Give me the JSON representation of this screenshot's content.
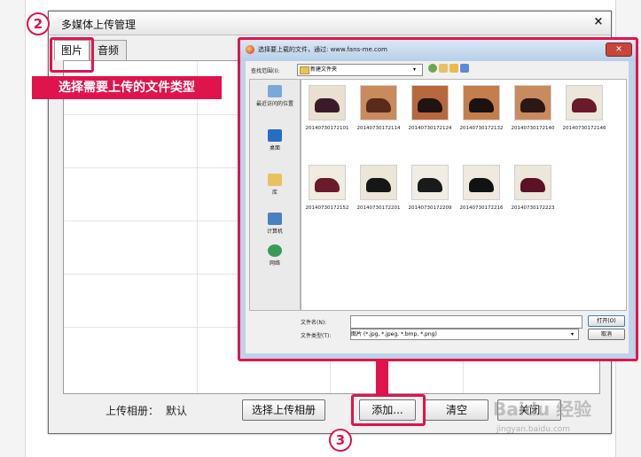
{
  "main_dialog": {
    "title": "多媒体上传管理",
    "close_glyph": "×",
    "tabs": [
      "图片",
      "音频"
    ],
    "album_label": "上传相册：",
    "album_value": "默认",
    "buttons": {
      "choose_album": "选择上传相册",
      "add": "添加...",
      "clear": "清空",
      "close": "关闭"
    }
  },
  "annotations": {
    "step2": "2",
    "step3": "3",
    "callout": "选择需要上传的文件类型",
    "accent_color": "#e0144c"
  },
  "file_dialog": {
    "title": "选择要上载的文件，通过: www.fans-me.com",
    "look_in_label": "查找范围(I):",
    "look_in_value": "新建文件夹",
    "places": [
      {
        "label": "最近访问的位置",
        "icon": "recent-places-icon"
      },
      {
        "label": "桌面",
        "icon": "desktop-icon"
      },
      {
        "label": "库",
        "icon": "library-icon"
      },
      {
        "label": "计算机",
        "icon": "computer-icon"
      },
      {
        "label": "网络",
        "icon": "network-icon"
      }
    ],
    "files": [
      "20140730172101",
      "20140730172114",
      "20140730172124",
      "20140730172132",
      "20140730172140",
      "20140730172146",
      "20140730172152",
      "20140730172201",
      "20140730172209",
      "20140730172216",
      "20140730172223"
    ],
    "filename_label": "文件名(N):",
    "filename_value": "",
    "filetype_label": "文件类型(T):",
    "filetype_value": "图片 (*.jpg, *.jpeg, *.bmp, *.png)",
    "open_button": "打开(O)",
    "cancel_button": "取消"
  },
  "watermark": {
    "text": "Baidu 经验",
    "url": "jingyan.baidu.com"
  }
}
